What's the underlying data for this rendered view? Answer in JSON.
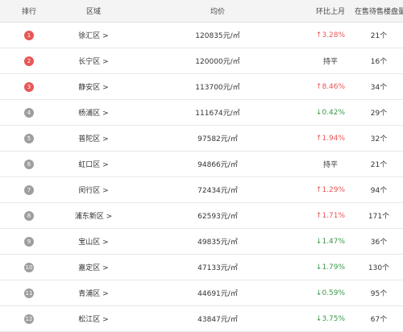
{
  "header": {
    "rank": "排行",
    "district": "区域",
    "avg_price": "均价",
    "change": "环比上月",
    "listings": "在售待售楼盘量"
  },
  "rows": [
    {
      "rank": "1",
      "district": "徐汇区 >",
      "price": "120835元/㎡",
      "change": "↑3.28%",
      "trend": "up",
      "count": "21个"
    },
    {
      "rank": "2",
      "district": "长宁区 >",
      "price": "120000元/㎡",
      "change": "持平",
      "trend": "flat",
      "count": "16个"
    },
    {
      "rank": "3",
      "district": "静安区 >",
      "price": "113700元/㎡",
      "change": "↑8.46%",
      "trend": "up",
      "count": "34个"
    },
    {
      "rank": "4",
      "district": "杨浦区 >",
      "price": "111674元/㎡",
      "change": "↓0.42%",
      "trend": "down",
      "count": "29个"
    },
    {
      "rank": "5",
      "district": "普陀区 >",
      "price": "97582元/㎡",
      "change": "↑1.94%",
      "trend": "up",
      "count": "32个"
    },
    {
      "rank": "6",
      "district": "虹口区 >",
      "price": "94866元/㎡",
      "change": "持平",
      "trend": "flat",
      "count": "21个"
    },
    {
      "rank": "7",
      "district": "闵行区 >",
      "price": "72434元/㎡",
      "change": "↑1.29%",
      "trend": "up",
      "count": "94个"
    },
    {
      "rank": "8",
      "district": "浦东新区 >",
      "price": "62593元/㎡",
      "change": "↑1.71%",
      "trend": "up",
      "count": "171个"
    },
    {
      "rank": "9",
      "district": "宝山区 >",
      "price": "49835元/㎡",
      "change": "↓1.47%",
      "trend": "down",
      "count": "36个"
    },
    {
      "rank": "10",
      "district": "嘉定区 >",
      "price": "47133元/㎡",
      "change": "↓1.79%",
      "trend": "down",
      "count": "130个"
    },
    {
      "rank": "11",
      "district": "青浦区 >",
      "price": "44691元/㎡",
      "change": "↓0.59%",
      "trend": "down",
      "count": "95个"
    },
    {
      "rank": "12",
      "district": "松江区 >",
      "price": "43847元/㎡",
      "change": "↓3.75%",
      "trend": "down",
      "count": "67个"
    }
  ],
  "colors": {
    "top_badge": "#e85656",
    "badge": "#9e9e9e",
    "up": "#e85656",
    "down": "#3a9a4a"
  }
}
